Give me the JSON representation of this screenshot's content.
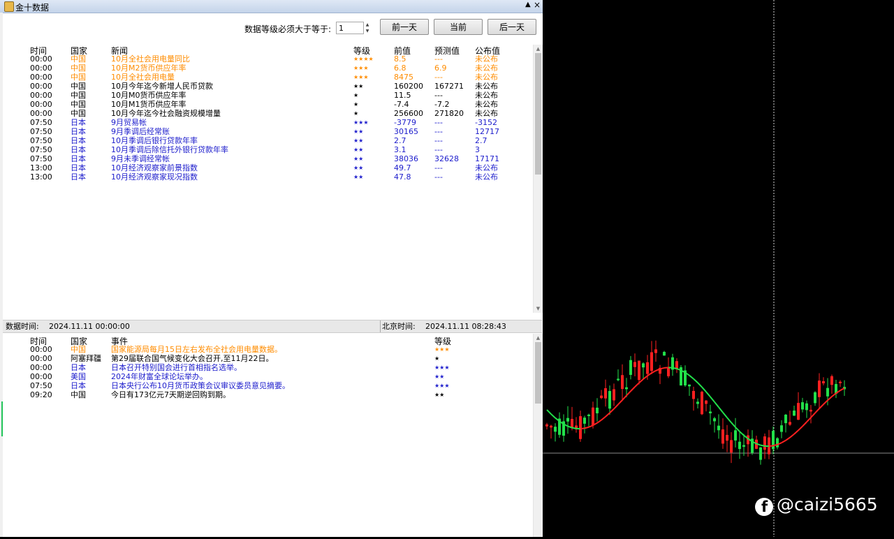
{
  "window": {
    "title": "金十数据",
    "pin": "▲",
    "close": "×"
  },
  "filter": {
    "label": "数据等级必须大于等于:",
    "value": "1"
  },
  "buttons": {
    "prev": "前一天",
    "today": "当前",
    "next": "后一天"
  },
  "news": {
    "headers": {
      "time": "时间",
      "country": "国家",
      "news": "新闻",
      "level": "等级",
      "prev": "前值",
      "forecast": "预测值",
      "actual": "公布值"
    },
    "rows": [
      {
        "time": "00:00",
        "country": "中国",
        "news": "10月全社会用电量同比",
        "level": "★★★★",
        "prev": "8.5",
        "forecast": "---",
        "actual": "未公布",
        "color": "#ff8c00"
      },
      {
        "time": "00:00",
        "country": "中国",
        "news": "10月M2货币供应年率",
        "level": "★★★",
        "prev": "6.8",
        "forecast": "6.9",
        "actual": "未公布",
        "color": "#ff8c00"
      },
      {
        "time": "00:00",
        "country": "中国",
        "news": "10月全社会用电量",
        "level": "★★★",
        "prev": "8475",
        "forecast": "---",
        "actual": "未公布",
        "color": "#ff8c00"
      },
      {
        "time": "00:00",
        "country": "中国",
        "news": "10月今年迄今新增人民币贷款",
        "level": "★★",
        "prev": "160200",
        "forecast": "167271",
        "actual": "未公布",
        "color": "#000000"
      },
      {
        "time": "00:00",
        "country": "中国",
        "news": "10月M0货币供应年率",
        "level": "★",
        "prev": "11.5",
        "forecast": "---",
        "actual": "未公布",
        "color": "#000000"
      },
      {
        "time": "00:00",
        "country": "中国",
        "news": "10月M1货币供应年率",
        "level": "★",
        "prev": "-7.4",
        "forecast": "-7.2",
        "actual": "未公布",
        "color": "#000000"
      },
      {
        "time": "00:00",
        "country": "中国",
        "news": "10月今年迄今社会融资规模增量",
        "level": "★",
        "prev": "256600",
        "forecast": "271820",
        "actual": "未公布",
        "color": "#000000"
      },
      {
        "time": "07:50",
        "country": "日本",
        "news": "9月贸易帐",
        "level": "★★★",
        "prev": "-3779",
        "forecast": "---",
        "actual": "-3152",
        "color": "#1c1ccc"
      },
      {
        "time": "07:50",
        "country": "日本",
        "news": "9月季调后经常账",
        "level": "★★",
        "prev": "30165",
        "forecast": "---",
        "actual": "12717",
        "color": "#1c1ccc"
      },
      {
        "time": "07:50",
        "country": "日本",
        "news": "10月季调后银行贷款年率",
        "level": "★★",
        "prev": "2.7",
        "forecast": "---",
        "actual": "2.7",
        "color": "#1c1ccc"
      },
      {
        "time": "07:50",
        "country": "日本",
        "news": "10月季调后除信托外银行贷款年率",
        "level": "★★",
        "prev": "3.1",
        "forecast": "---",
        "actual": "3",
        "color": "#1c1ccc"
      },
      {
        "time": "07:50",
        "country": "日本",
        "news": "9月未季调经常帐",
        "level": "★★",
        "prev": "38036",
        "forecast": "32628",
        "actual": "17171",
        "color": "#1c1ccc"
      },
      {
        "time": "13:00",
        "country": "日本",
        "news": "10月经济观察家前景指数",
        "level": "★★",
        "prev": "49.7",
        "forecast": "---",
        "actual": "未公布",
        "color": "#1c1ccc"
      },
      {
        "time": "13:00",
        "country": "日本",
        "news": "10月经济观察家现况指数",
        "level": "★★",
        "prev": "47.8",
        "forecast": "---",
        "actual": "未公布",
        "color": "#1c1ccc"
      }
    ]
  },
  "status": {
    "data_time_label": "数据时间:",
    "data_time": "2024.11.11 00:00:00",
    "beijing_label": "北京时间:",
    "beijing_time": "2024.11.11 08:28:43"
  },
  "events": {
    "headers": {
      "time": "时间",
      "country": "国家",
      "event": "事件",
      "level": "等级"
    },
    "rows": [
      {
        "time": "00:00",
        "country": "中国",
        "event": "国家能源局每月15日左右发布全社会用电量数据。",
        "level": "★★★",
        "color": "#ff8c00"
      },
      {
        "time": "00:00",
        "country": "阿塞拜疆",
        "event": "第29届联合国气候变化大会召开,至11月22日。",
        "level": "★",
        "color": "#000000"
      },
      {
        "time": "00:00",
        "country": "日本",
        "event": "日本召开特别国会进行首相指名选举。",
        "level": "★★★",
        "color": "#1c1ccc"
      },
      {
        "time": "00:00",
        "country": "美国",
        "event": "2024年财富全球论坛举办。",
        "level": "★★",
        "color": "#1c1ccc"
      },
      {
        "time": "07:50",
        "country": "日本",
        "event": "日本央行公布10月货币政策会议审议委员意见摘要。",
        "level": "★★★",
        "color": "#1c1ccc"
      },
      {
        "time": "09:20",
        "country": "中国",
        "event": "今日有173亿元7天期逆回购到期。",
        "level": "★★",
        "color": "#000000"
      }
    ]
  },
  "chart_watermark": "@caizi5665",
  "colors": {
    "bull": "#22e04a",
    "bear": "#ff2020",
    "ma_up": "#ff2020",
    "ma_down": "#22e04a"
  }
}
